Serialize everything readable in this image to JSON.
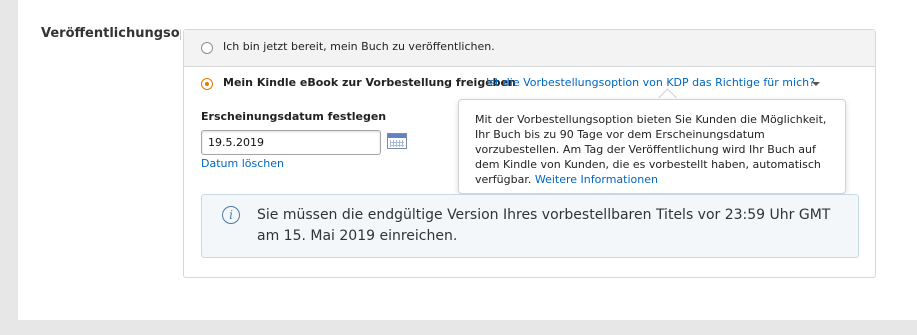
{
  "section": {
    "label": "Veröffentlichungsop"
  },
  "options": {
    "ready": {
      "label": "Ich bin jetzt bereit, mein Buch zu veröffentlichen.",
      "selected": false
    },
    "preorder": {
      "label": "Mein Kindle eBook zur Vorbestellung freigeben",
      "selected": true,
      "help_link": "Ist die Vorbestellungsoption von KDP das Richtige für mich?"
    }
  },
  "release_date": {
    "label": "Erscheinungsdatum festlegen",
    "value": "19.5.2019",
    "clear_link": "Datum löschen",
    "calendar_icon": "calendar-icon"
  },
  "tooltip": {
    "text": "Mit der Vorbestellungsoption bieten Sie Kunden die Möglichkeit, Ihr Buch bis zu 90 Tage vor dem Erscheinungsdatum vorzubestellen. Am Tag der Veröffentlichung wird Ihr Buch auf dem Kindle von Kunden, die es vorbestellt haben, automatisch verfügbar.",
    "more_link": "Weitere Informationen"
  },
  "alert": {
    "icon": "info-icon",
    "text": "Sie müssen die endgültige Version Ihres vorbestellbaren Titels vor 23:59 Uhr GMT am 15. Mai 2019 einreichen."
  },
  "colors": {
    "accent_radio": "#e77600",
    "link": "#0066c0",
    "alert_bg": "#f3f7fa"
  }
}
